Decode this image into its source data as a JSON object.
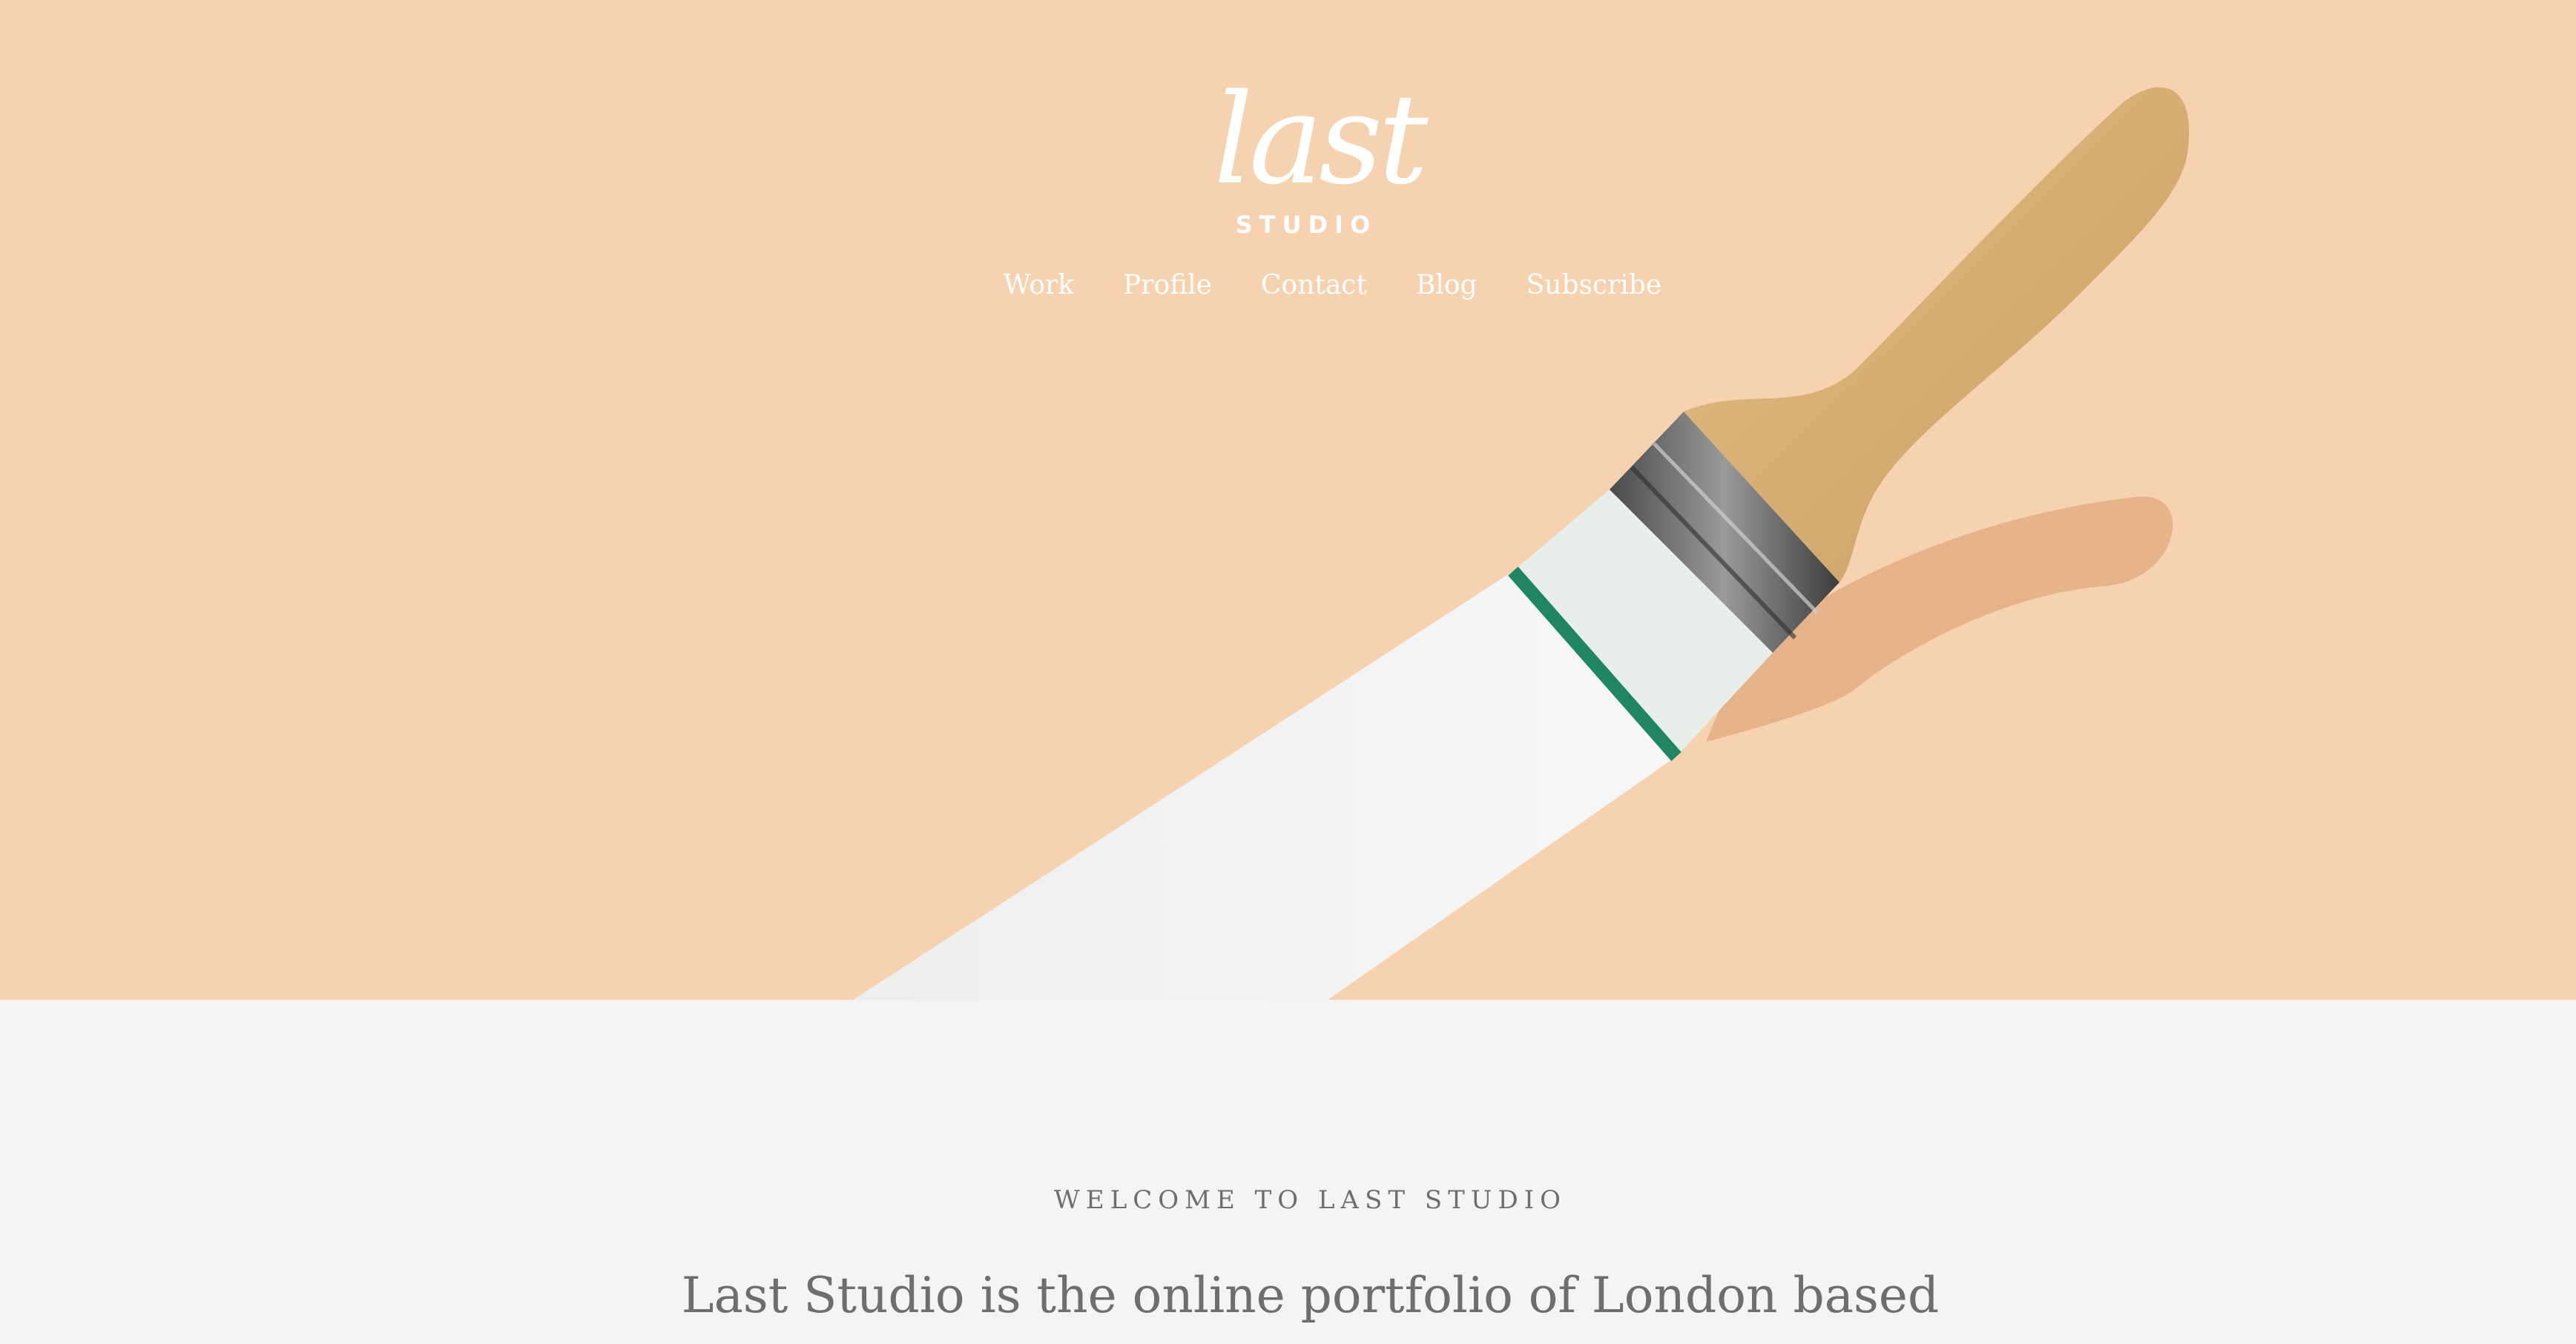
{
  "brand": {
    "logo_script": "last",
    "logo_subtitle": "STUDIO"
  },
  "nav": {
    "items": [
      {
        "label": "Work"
      },
      {
        "label": "Profile"
      },
      {
        "label": "Contact"
      },
      {
        "label": "Blog"
      },
      {
        "label": "Subscribe"
      }
    ]
  },
  "hero": {
    "background_color": "#f6d2b0",
    "image": "paintbrush-with-white-paint-stroke"
  },
  "welcome": {
    "eyebrow": "WELCOME TO LAST STUDIO",
    "intro": "Last Studio is the online portfolio of London based"
  },
  "colors": {
    "page_background": "#f4f4f4",
    "text": "#6e6e6e",
    "nav_text": "#ffffff"
  }
}
